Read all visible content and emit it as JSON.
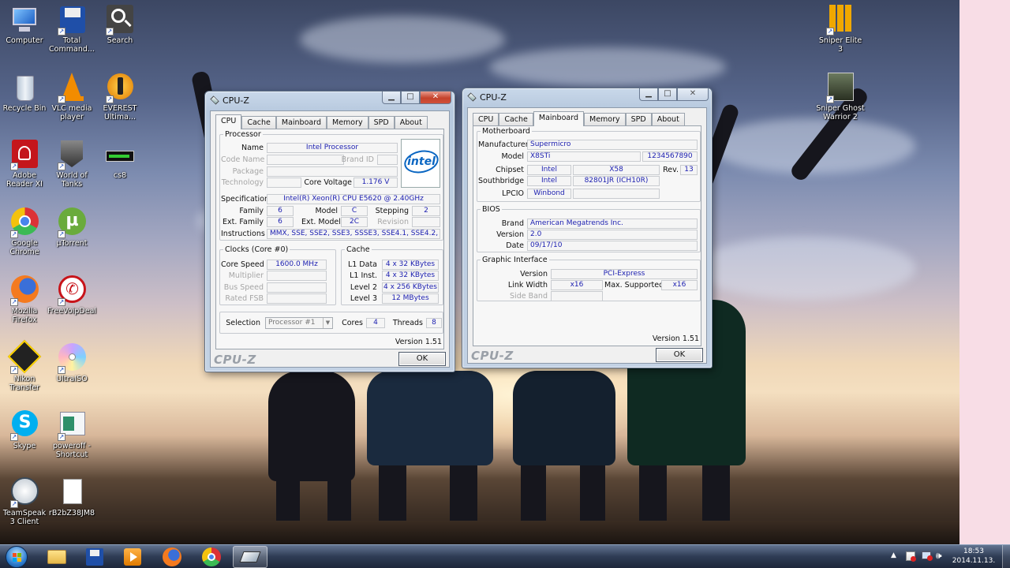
{
  "desktop": {
    "icons": [
      {
        "label": "Computer"
      },
      {
        "label": "Total Command..."
      },
      {
        "label": "Search"
      },
      {
        "label": "Recycle Bin"
      },
      {
        "label": "VLC media player"
      },
      {
        "label": "EVEREST Ultima..."
      },
      {
        "label": "Adobe Reader XI"
      },
      {
        "label": "World of Tanks"
      },
      {
        "label": "cs8"
      },
      {
        "label": "Google Chrome"
      },
      {
        "label": "µTorrent"
      },
      {
        "label": "Mozilla Firefox"
      },
      {
        "label": "FreeVoipDeal"
      },
      {
        "label": "Nikon Transfer"
      },
      {
        "label": "UltraISO"
      },
      {
        "label": "Skype"
      },
      {
        "label": "poweroff - Shortcut"
      },
      {
        "label": "TeamSpeak 3 Client"
      },
      {
        "label": "rB2bZ38JM8"
      },
      {
        "label": "Sniper Elite 3"
      },
      {
        "label": "Sniper Ghost Warrior 2"
      }
    ]
  },
  "window_cpu": {
    "title": "CPU-Z",
    "tabs": [
      "CPU",
      "Cache",
      "Mainboard",
      "Memory",
      "SPD",
      "About"
    ],
    "active_tab": "CPU",
    "processor": {
      "legend": "Processor",
      "name_label": "Name",
      "name": "Intel Processor",
      "codename_label": "Code Name",
      "brandid_label": "Brand ID",
      "package_label": "Package",
      "technology_label": "Technology",
      "corevoltage_label": "Core Voltage",
      "corevoltage": "1.176 V",
      "spec_label": "Specification",
      "spec": "Intel(R) Xeon(R) CPU      E5620  @ 2.40GHz",
      "family_label": "Family",
      "family": "6",
      "model_label": "Model",
      "model": "C",
      "stepping_label": "Stepping",
      "stepping": "2",
      "extfamily_label": "Ext. Family",
      "extfamily": "6",
      "extmodel_label": "Ext. Model",
      "extmodel": "2C",
      "revision_label": "Revision",
      "instructions_label": "Instructions",
      "instructions": "MMX, SSE, SSE2, SSE3, SSSE3, SSE4.1, SSE4.2, EM64T",
      "logo_text": "intel"
    },
    "clocks": {
      "legend": "Clocks (Core #0)",
      "corespeed_label": "Core Speed",
      "corespeed": "1600.0 MHz",
      "multiplier_label": "Multiplier",
      "busspeed_label": "Bus Speed",
      "ratedfsb_label": "Rated FSB"
    },
    "cache": {
      "legend": "Cache",
      "l1data_label": "L1 Data",
      "l1data": "4 x 32 KBytes",
      "l1inst_label": "L1 Inst.",
      "l1inst": "4 x 32 KBytes",
      "level2_label": "Level 2",
      "level2": "4 x 256 KBytes",
      "level3_label": "Level 3",
      "level3": "12 MBytes"
    },
    "selection_label": "Selection",
    "selection": "Processor #1",
    "cores_label": "Cores",
    "cores": "4",
    "threads_label": "Threads",
    "threads": "8",
    "version": "Version 1.51",
    "footer": "CPU-Z",
    "ok": "OK"
  },
  "window_mb": {
    "title": "CPU-Z",
    "tabs": [
      "CPU",
      "Cache",
      "Mainboard",
      "Memory",
      "SPD",
      "About"
    ],
    "active_tab": "Mainboard",
    "motherboard": {
      "legend": "Motherboard",
      "manufacturer_label": "Manufacturer",
      "manufacturer": "Supermicro",
      "model_label": "Model",
      "model": "X8STi",
      "model_serial": "1234567890",
      "chipset_label": "Chipset",
      "chipset_vendor": "Intel",
      "chipset": "X58",
      "rev_label": "Rev.",
      "rev": "13",
      "southbridge_label": "Southbridge",
      "southbridge_vendor": "Intel",
      "southbridge": "82801JR (ICH10R)",
      "lpcio_label": "LPCIO",
      "lpcio": "Winbond"
    },
    "bios": {
      "legend": "BIOS",
      "brand_label": "Brand",
      "brand": "American Megatrends Inc.",
      "version_label": "Version",
      "version": "2.0",
      "date_label": "Date",
      "date": "09/17/10"
    },
    "graphic": {
      "legend": "Graphic Interface",
      "version_label": "Version",
      "version": "PCI-Express",
      "linkwidth_label": "Link Width",
      "linkwidth": "x16",
      "maxsupported_label": "Max. Supported",
      "maxsupported": "x16",
      "sideband_label": "Side Band"
    },
    "version": "Version 1.51",
    "footer": "CPU-Z",
    "ok": "OK"
  },
  "taskbar": {
    "time": "18:53",
    "date": "2014.11.13."
  }
}
